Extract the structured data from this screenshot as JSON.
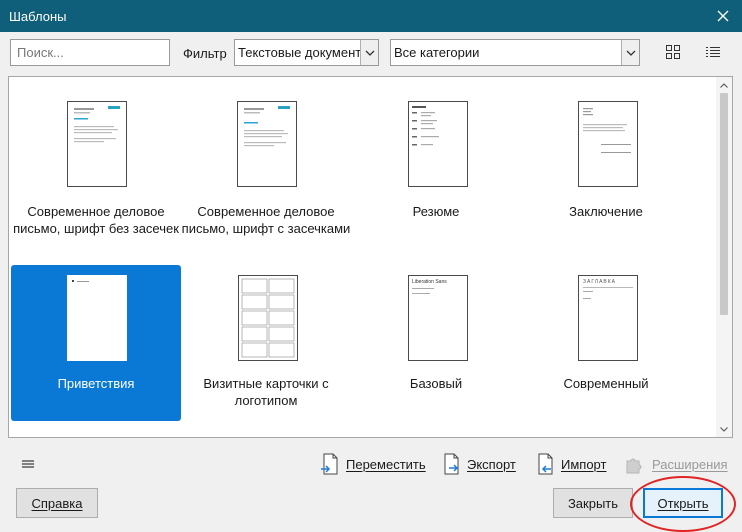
{
  "window": {
    "title": "Шаблоны",
    "close_icon": "close-icon"
  },
  "toolbar": {
    "search_placeholder": "Поиск...",
    "filter_label": "Фильтр",
    "filter_value": "Текстовые документы",
    "category_value": "Все категории",
    "view_icons": [
      "thumbnail-view-icon",
      "list-view-icon"
    ]
  },
  "templates": [
    {
      "label": "Современное деловое письмо, шрифт без засечек",
      "selected": false
    },
    {
      "label": "Современное деловое письмо, шрифт с засечками",
      "selected": false
    },
    {
      "label": "Резюме",
      "selected": false
    },
    {
      "label": "Заключение",
      "selected": false
    },
    {
      "label": "Приветствия",
      "selected": true
    },
    {
      "label": "Визитные карточки с логотипом",
      "selected": false
    },
    {
      "label": "Базовый",
      "selected": false
    },
    {
      "label": "Современный",
      "selected": false
    }
  ],
  "thumb_text": {
    "basic_heading": "Liberation Sans",
    "modern_heading": "ЗАГЛАВКА"
  },
  "actions": {
    "move": "Переместить",
    "export": "Экспорт",
    "import": "Импорт",
    "extensions": "Расширения"
  },
  "buttons": {
    "help": "Справка",
    "close": "Закрыть",
    "open": "Открыть"
  },
  "colors": {
    "titlebar": "#0f5f7a",
    "selection": "#0a79d6",
    "annotation": "#e02424"
  }
}
